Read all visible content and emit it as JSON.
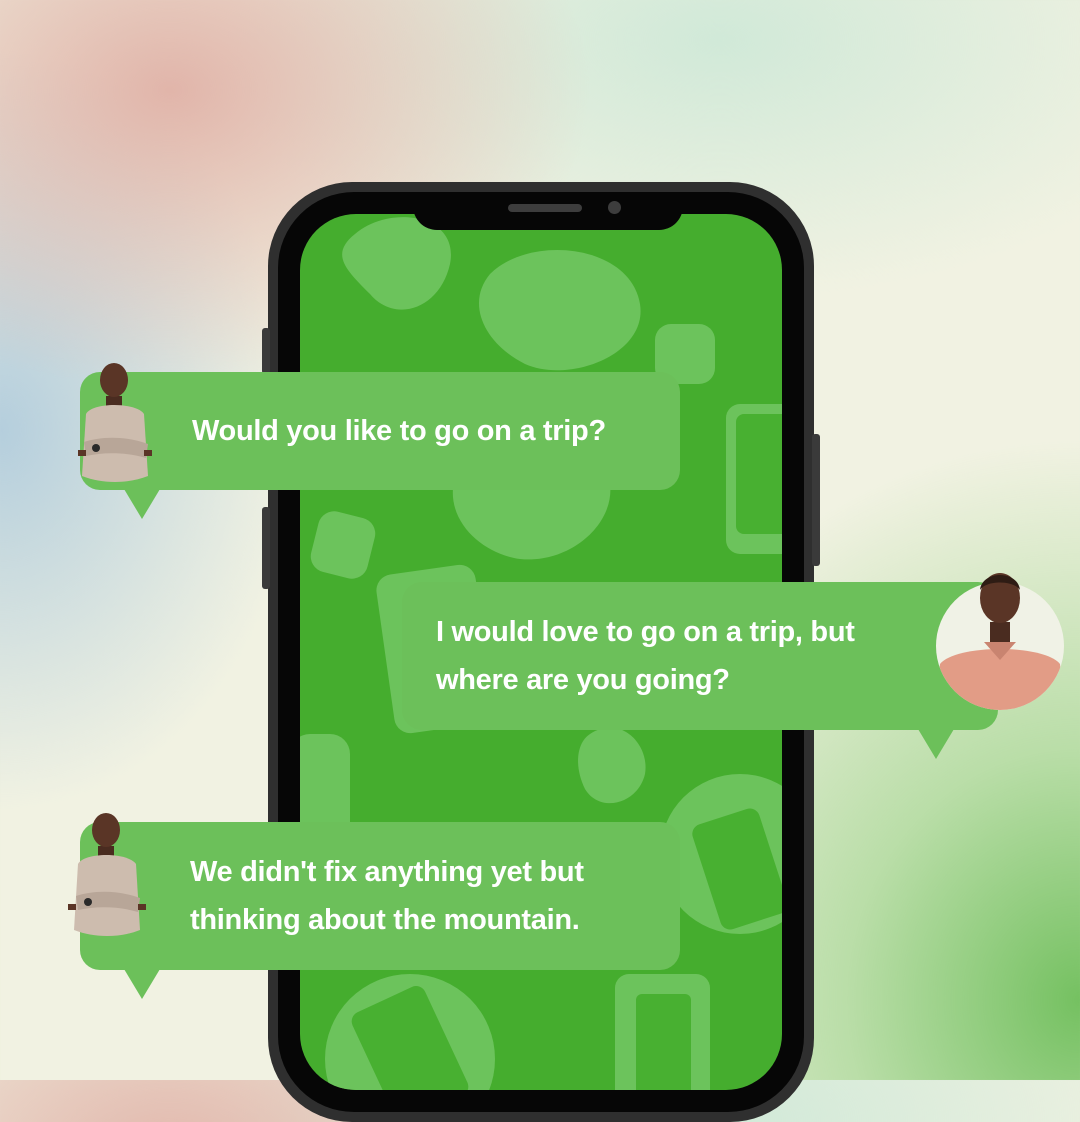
{
  "messages": [
    {
      "sender": "man-in-beige-sweater",
      "lines": [
        "Would you like to go on a trip?"
      ]
    },
    {
      "sender": "man-in-pink-polo",
      "lines": [
        "I would love to go on a trip, but",
        "where are you going?"
      ]
    },
    {
      "sender": "man-in-beige-sweater",
      "lines": [
        "We didn't fix anything yet but",
        "thinking about the mountain."
      ]
    }
  ],
  "colors": {
    "bubble": "#6cc05a",
    "screen": "#45ad2e",
    "screen_pattern": "#6cc35c",
    "phone_frame": "#2f2f2f",
    "text": "#ffffff"
  },
  "icons": [
    "phone-shape-icon",
    "blob-shape-icon"
  ]
}
